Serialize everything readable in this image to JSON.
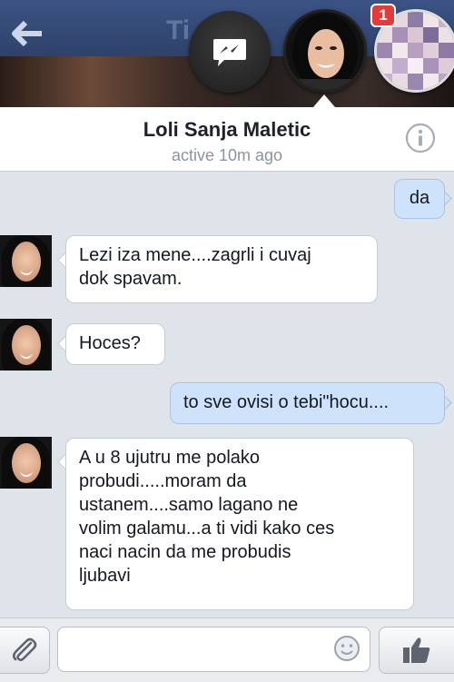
{
  "header": {
    "title_partial": "Ti      e",
    "notification_count": "1"
  },
  "contact": {
    "name": "Loli Sanja Maletic",
    "status": "active 10m ago"
  },
  "messages": [
    {
      "from": "me",
      "text": "da"
    },
    {
      "from": "them",
      "lines": [
        "Lezi iza mene....zagrli i cuvaj",
        "dok spavam."
      ]
    },
    {
      "from": "them",
      "lines": [
        "Hoces?"
      ]
    },
    {
      "from": "me",
      "text": "to sve ovisi o tebi\"hocu...."
    },
    {
      "from": "them",
      "lines": [
        "A u 8 ujutru me polako",
        "probudi.....moram da",
        "ustanem....samo lagano ne",
        "volim galamu...a ti vidi kako ces",
        "naci nacin da me probudis",
        "ljubavi"
      ]
    }
  ],
  "composer": {
    "placeholder": ""
  },
  "icons": {
    "back": "back-arrow-icon",
    "messenger": "messenger-bolt-icon",
    "info": "info-icon",
    "attach": "paperclip-icon",
    "emoji": "smiley-icon",
    "like": "thumbs-up-icon"
  },
  "colors": {
    "outgoing_bubble": "#cfe2fb",
    "incoming_bubble": "#ffffff",
    "badge": "#e23b3b"
  }
}
